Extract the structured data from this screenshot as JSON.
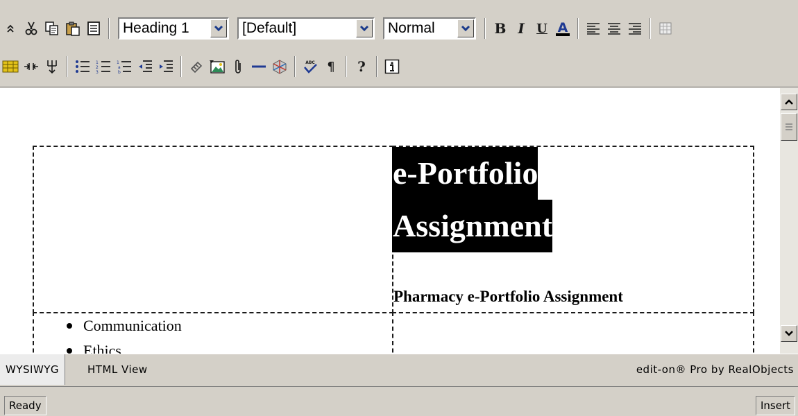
{
  "toolbar": {
    "row1": [
      {
        "type": "button",
        "name": "collapse-toolbar-icon",
        "glyph": "⌃"
      },
      {
        "type": "button",
        "name": "cut-icon",
        "glyph": "✂"
      },
      {
        "type": "button",
        "name": "copy-icon"
      },
      {
        "type": "button",
        "name": "paste-icon"
      },
      {
        "type": "button",
        "name": "paste-text-icon"
      },
      {
        "type": "sep"
      },
      {
        "type": "combo",
        "name": "paragraph-style-select",
        "value": "Heading 1",
        "width": 160
      },
      {
        "type": "combo",
        "name": "font-family-select",
        "value": "[Default]",
        "width": 198
      },
      {
        "type": "combo",
        "name": "font-size-select",
        "value": "Normal",
        "width": 134
      },
      {
        "type": "sep"
      },
      {
        "type": "button",
        "name": "bold-icon",
        "text": "B",
        "cls": "b-bold"
      },
      {
        "type": "button",
        "name": "italic-icon",
        "text": "I",
        "cls": "b-ital"
      },
      {
        "type": "button",
        "name": "underline-icon",
        "text": "U",
        "cls": "b-under"
      },
      {
        "type": "button",
        "name": "font-color-icon",
        "text": "A"
      },
      {
        "type": "sep"
      },
      {
        "type": "button",
        "name": "align-left-icon"
      },
      {
        "type": "button",
        "name": "align-center-icon"
      },
      {
        "type": "button",
        "name": "align-right-icon"
      },
      {
        "type": "sep"
      },
      {
        "type": "button",
        "name": "table-icon"
      }
    ],
    "row2": [
      {
        "type": "button",
        "name": "table-properties-icon"
      },
      {
        "type": "button",
        "name": "split-cell-icon"
      },
      {
        "type": "button",
        "name": "merge-cell-icon"
      },
      {
        "type": "sep"
      },
      {
        "type": "button",
        "name": "bulleted-list-icon"
      },
      {
        "type": "button",
        "name": "numbered-list-icon"
      },
      {
        "type": "button",
        "name": "multilevel-list-icon"
      },
      {
        "type": "button",
        "name": "outdent-icon"
      },
      {
        "type": "button",
        "name": "indent-icon"
      },
      {
        "type": "sep"
      },
      {
        "type": "button",
        "name": "hyperlink-icon"
      },
      {
        "type": "button",
        "name": "insert-image-icon"
      },
      {
        "type": "button",
        "name": "attachment-icon"
      },
      {
        "type": "button",
        "name": "horizontal-rule-icon"
      },
      {
        "type": "button",
        "name": "insert-object-icon"
      },
      {
        "type": "sep"
      },
      {
        "type": "button",
        "name": "spellcheck-icon",
        "text": "ABC"
      },
      {
        "type": "button",
        "name": "paragraph-marks-icon",
        "text": "¶"
      },
      {
        "type": "sep"
      },
      {
        "type": "button",
        "name": "help-icon",
        "text": "?",
        "cls": "b-help"
      },
      {
        "type": "sep"
      },
      {
        "type": "button",
        "name": "info-icon",
        "text": "i"
      }
    ]
  },
  "document": {
    "title_line1": "e-Portfolio",
    "title_line2": "Assignment",
    "subtitle": "Pharmacy e-Portfolio Assignment",
    "bullets": [
      "Communication",
      "Ethics"
    ]
  },
  "view_tabs": {
    "wysiwyg": "WYSIWYG",
    "html": "HTML View"
  },
  "brand": "edit-on® Pro by RealObjects",
  "status": {
    "left": "Ready",
    "right": "Insert"
  },
  "colors": {
    "chrome": "#d4d0c8",
    "selection": "#000000",
    "icon_blue": "#1f3a93",
    "icon_yellow": "#e3c21a"
  }
}
